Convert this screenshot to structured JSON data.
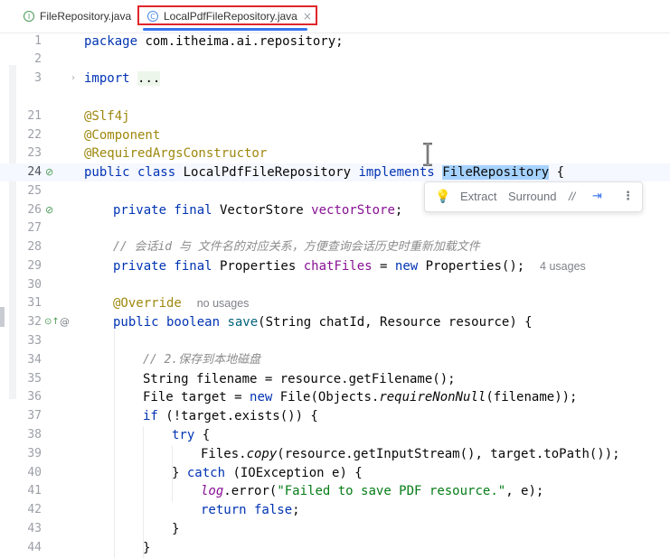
{
  "tabs": [
    {
      "label": "FileRepository.java",
      "icon": "interface-icon",
      "icon_glyph": "I",
      "active": false
    },
    {
      "label": "LocalPdfFileRepository.java",
      "icon": "class-icon",
      "icon_glyph": "C",
      "active": true,
      "close_glyph": "×"
    }
  ],
  "editor": {
    "lines": [
      {
        "num": "1",
        "text": "package com.itheima.ai.repository;"
      },
      {
        "num": "2",
        "text": ""
      },
      {
        "num": "3",
        "text": "import ..."
      },
      {
        "num": "21",
        "text": "@Slf4j"
      },
      {
        "num": "22",
        "text": "@Component"
      },
      {
        "num": "23",
        "text": "@RequiredArgsConstructor"
      },
      {
        "num": "24",
        "text": "public class LocalPdfFileRepository implements FileRepository {"
      },
      {
        "num": "25",
        "text": ""
      },
      {
        "num": "26",
        "text": "private final VectorStore vectorStore;"
      },
      {
        "num": "27",
        "text": ""
      },
      {
        "num": "28",
        "text": "// 会话id 与 文件名的对应关系，方便查询会话历史时重新加载文件"
      },
      {
        "num": "29",
        "text": "private final Properties chatFiles = new Properties();",
        "hint": "4 usages"
      },
      {
        "num": "30",
        "text": ""
      },
      {
        "num": "31",
        "text": "@Override",
        "hint": "no usages"
      },
      {
        "num": "32",
        "text": "public boolean save(String chatId, Resource resource) {"
      },
      {
        "num": "33",
        "text": ""
      },
      {
        "num": "34",
        "text": "// 2.保存到本地磁盘"
      },
      {
        "num": "35",
        "text": "String filename = resource.getFilename();"
      },
      {
        "num": "36",
        "text": "File target = new File(Objects.requireNonNull(filename));"
      },
      {
        "num": "37",
        "text": "if (!target.exists()) {"
      },
      {
        "num": "38",
        "text": "try {"
      },
      {
        "num": "39",
        "text": "Files.copy(resource.getInputStream(), target.toPath());"
      },
      {
        "num": "40",
        "text": "} catch (IOException e) {"
      },
      {
        "num": "41",
        "text": "log.error(\"Failed to save PDF resource.\", e);"
      },
      {
        "num": "42",
        "text": "return false;"
      },
      {
        "num": "43",
        "text": "}"
      },
      {
        "num": "44",
        "text": "}"
      }
    ]
  },
  "popup": {
    "items": [
      {
        "name": "bulb-icon",
        "glyph": "💡"
      },
      {
        "name": "extract-action",
        "label": "Extract"
      },
      {
        "name": "surround-action",
        "label": "Surround"
      },
      {
        "name": "comment-action",
        "label": "//"
      },
      {
        "name": "indent-icon",
        "glyph": "⇥"
      },
      {
        "name": "more-options-icon",
        "glyph": "⋮"
      }
    ]
  },
  "gutter_icons": {
    "line24": {
      "name": "implementation-icon",
      "glyph": "⊘"
    },
    "line26": {
      "name": "injection-icon",
      "glyph": "⊘"
    },
    "line32_a": {
      "name": "override-icon",
      "glyph": "⊙↑"
    },
    "line32_b": {
      "name": "annotation-at-icon",
      "glyph": "@"
    }
  },
  "colors": {
    "keyword": "#0033b3",
    "annotation": "#9e880d",
    "field": "#871094",
    "string": "#067d17",
    "comment": "#8c8c8c",
    "selection": "#a6d2ff",
    "tab_highlight_box": "#e0262b",
    "tab_underline": "#3574f0"
  }
}
